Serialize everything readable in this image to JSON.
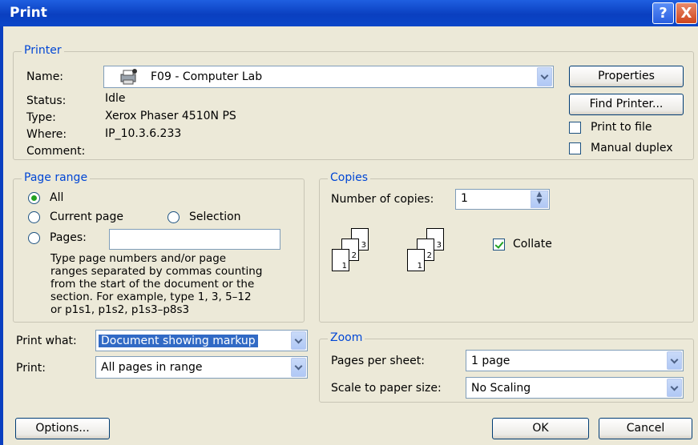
{
  "title": "Print",
  "title_buttons": {
    "help": "?",
    "close": "X"
  },
  "printer": {
    "legend": "Printer",
    "name_label": "Name:",
    "name_value": "F09 - Computer Lab",
    "status_label": "Status:",
    "status_value": "Idle",
    "type_label": "Type:",
    "type_value": "Xerox Phaser 4510N PS",
    "where_label": "Where:",
    "where_value": "IP_10.3.6.233",
    "comment_label": "Comment:",
    "properties_button": "Properties",
    "find_printer_button": "Find Printer...",
    "print_to_file": {
      "label": "Print to file",
      "checked": false
    },
    "manual_duplex": {
      "label": "Manual duplex",
      "checked": false
    }
  },
  "page_range": {
    "legend": "Page range",
    "all": "All",
    "current": "Current page",
    "selection": "Selection",
    "pages": "Pages:",
    "selected": "All",
    "pages_value": "",
    "help_lines": [
      "Type page numbers and/or page",
      "ranges separated by commas counting",
      "from the start of the document or the",
      "section. For example, type 1, 3, 5–12",
      "or p1s1, p1s2, p1s3–p8s3"
    ]
  },
  "copies": {
    "legend": "Copies",
    "number_label": "Number of copies:",
    "number_value": "1",
    "collate": {
      "label": "Collate",
      "checked": true
    },
    "page_numbers": [
      "3",
      "2",
      "1"
    ]
  },
  "print_what": {
    "label": "Print what:",
    "value": "Document showing markup"
  },
  "print": {
    "label": "Print:",
    "value": "All pages in range"
  },
  "zoom": {
    "legend": "Zoom",
    "pps_label": "Pages per sheet:",
    "pps_value": "1 page",
    "scale_label": "Scale to paper size:",
    "scale_value": "No Scaling"
  },
  "buttons": {
    "options": "Options...",
    "ok": "OK",
    "cancel": "Cancel"
  },
  "colors": {
    "accent": "#0046d5",
    "titlebar": "#0a3fc0",
    "dialog_bg": "#ece9d8"
  }
}
